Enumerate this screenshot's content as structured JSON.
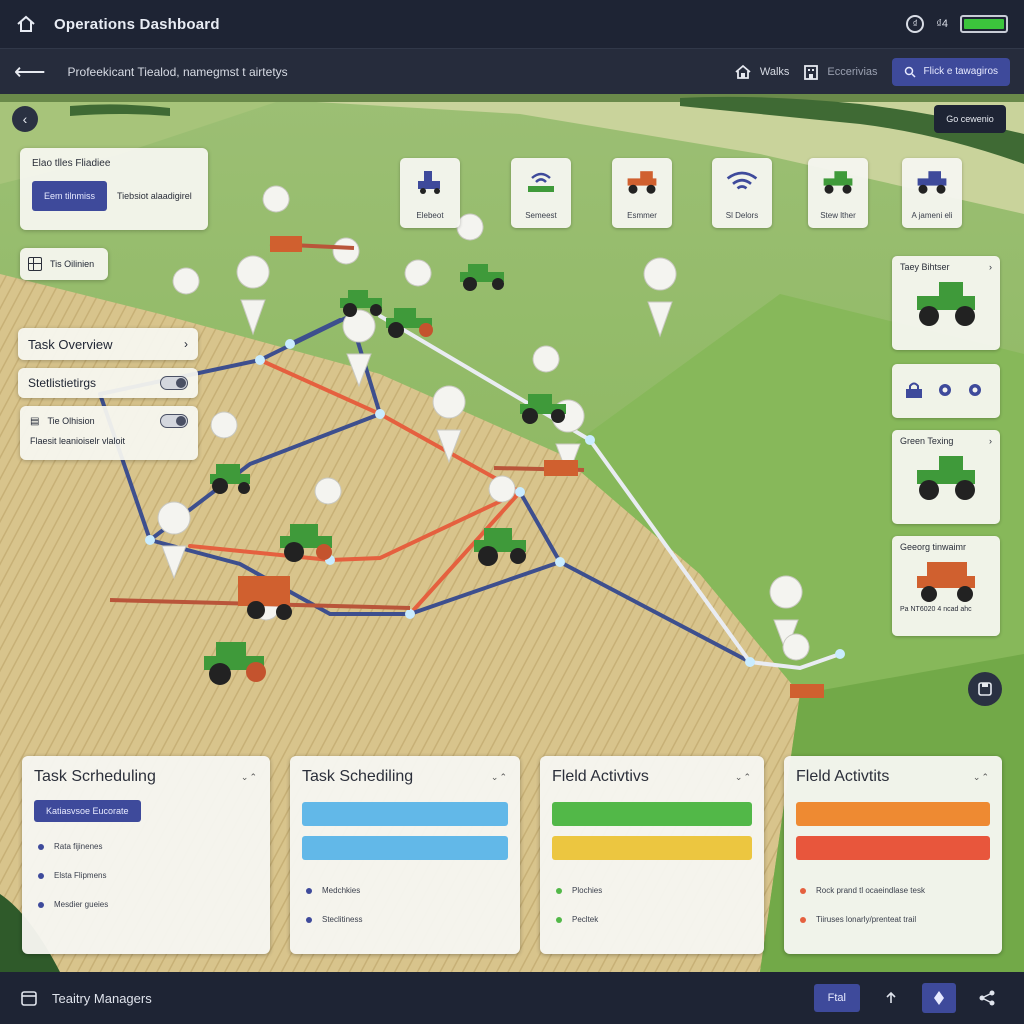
{
  "header": {
    "title": "Operations Dashboard",
    "status_small": "₫4",
    "battery_level": 1.0
  },
  "subbar": {
    "breadcrumb": "Profeekicant Tiealod, namegmst t airtetys",
    "nav_walks": "Walks",
    "nav_second": "Eccerivias",
    "primary_button": "Flick e tawagiros"
  },
  "map": {
    "go_button": "Go cewenio",
    "left_card": {
      "title": "Elao tlles Fliadiee",
      "button": "Eem tilnmiss",
      "subtitle": "Tiebsiot alaadigirel"
    },
    "chip_label": "Tis Oilinien",
    "task_overview": "Task Overview",
    "settings_label": "Stetlistietirgs",
    "division_card": {
      "title": "Tie Olhision",
      "subtitle": "Flaesit leanioiselr vlaloit"
    },
    "equipment": [
      {
        "label": "Elebeot",
        "icon": "planter-icon"
      },
      {
        "label": "Semeest",
        "icon": "wifi-device-icon"
      },
      {
        "label": "Esmmer",
        "icon": "orange-tractor-icon"
      },
      {
        "label": "Sl Delors",
        "icon": "wifi-icon"
      },
      {
        "label": "Stew lther",
        "icon": "green-tractor-icon"
      },
      {
        "label": "A jameni eli",
        "icon": "blue-tractor-icon"
      }
    ],
    "right_cards": [
      {
        "title": "Taey Bihtser"
      },
      {
        "title": "Green Texing"
      },
      {
        "title": "Geeorg tinwaimr",
        "footer": "Pa NT6020 4 ncad ahc"
      }
    ]
  },
  "bottom_cards": [
    {
      "title": "Task Scrheduling",
      "tag": "Katiasvsoe Eucorate",
      "items": [
        "Rata fijinenes",
        "Elsta Flipmens",
        "Mesdier gueies"
      ],
      "bars": []
    },
    {
      "title": "Task Schediling",
      "items": [
        "Medchkies",
        "Steclitiness"
      ],
      "bars": [
        {
          "color": "#62b8e8"
        },
        {
          "color": "#62b8e8"
        }
      ]
    },
    {
      "title": "Fleld Activtivs",
      "items": [
        "Plochies",
        "Pecltek"
      ],
      "bars": [
        {
          "color": "#52b848"
        },
        {
          "color": "#ecc640"
        }
      ]
    },
    {
      "title": "Fleld Activtits",
      "items": [
        "Rock prand tl ocaeindlase tesk",
        "Tiiruses lonarly/prenteat trail"
      ],
      "bars": [
        {
          "color": "#ee8a32"
        },
        {
          "color": "#e8563c"
        }
      ]
    }
  ],
  "footer": {
    "label": "Teaitry Managers",
    "button": "Ftal"
  },
  "colors": {
    "accent": "#3e4a9b",
    "dark": "#1e2434",
    "field_green": "#7fb24f",
    "path_red": "#e5603f",
    "path_blue": "#3d4f8e"
  }
}
